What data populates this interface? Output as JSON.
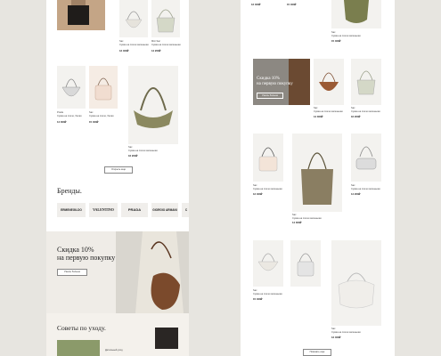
{
  "colors": {
    "background": "#e7e5e0",
    "promo_a": "#efece7",
    "promo_b": "#8c8882",
    "accent_olive": "#7a7e4e",
    "accent_brown": "#7b4a2c"
  },
  "left_column": {
    "top_products": [
      {
        "label": "Sac",
        "desc": "Сумка на плече маленькая",
        "price": "12 400₽"
      },
      {
        "label": "Mini Sac",
        "desc": "Сумка на плече маленькая",
        "price": "14 200₽"
      }
    ],
    "mid_products": [
      {
        "label": "Prada",
        "desc": "Сумка на плече, белая",
        "price": "14 300₽"
      },
      {
        "label": "Sac",
        "desc": "Сумка на плече, белая",
        "price": "15 400₽"
      },
      {
        "label": "Sac",
        "desc": "Сумка на плече маленькая",
        "price": "16 200₽"
      }
    ],
    "show_more_button": "Открыть еще",
    "brands_title": "Бренды.",
    "brands": [
      "ERMENEGILDO",
      "VALENTINO",
      "PRADA",
      "GIORGIO ARMANI",
      "C"
    ],
    "promo": {
      "line1": "Скидка 10%",
      "line2": "на первую покупку",
      "button": "Узнать больше"
    },
    "care_title": "Советы по уходу.",
    "care_item": "Детальный уход"
  },
  "right_column": {
    "products": [
      {
        "label": "",
        "desc": "",
        "price": "12 400₽"
      },
      {
        "label": "",
        "desc": "",
        "price": "15 400₽"
      },
      {
        "label": "Sac",
        "desc": "Сумка на плече маленькая",
        "price": "15 400₽"
      },
      {
        "label": "",
        "desc": "",
        "price": ""
      },
      {
        "label": "Sac",
        "desc": "Сумка на плече маленькая",
        "price": "14 300₽"
      },
      {
        "label": "Sac",
        "desc": "Сумка на плече маленькая",
        "price": "16 200₽"
      },
      {
        "label": "Sac",
        "desc": "Сумка на плече маленькая",
        "price": "12 400₽"
      },
      {
        "label": "Sac",
        "desc": "Сумка на плече маленькая",
        "price": "14 300₽"
      },
      {
        "label": "Sac",
        "desc": "Сумка на плече маленькая",
        "price": "14 200₽"
      },
      {
        "label": "Sac",
        "desc": "Сумка на плече маленькая",
        "price": "15 400₽"
      },
      {
        "label": "Sac",
        "desc": "Сумка на плече маленькая",
        "price": "12 400₽"
      }
    ],
    "promo": {
      "line1": "Скидка 10%",
      "line2": "на первую покупку",
      "button": "Узнать больше"
    },
    "show_more_button": "Показать еще"
  }
}
